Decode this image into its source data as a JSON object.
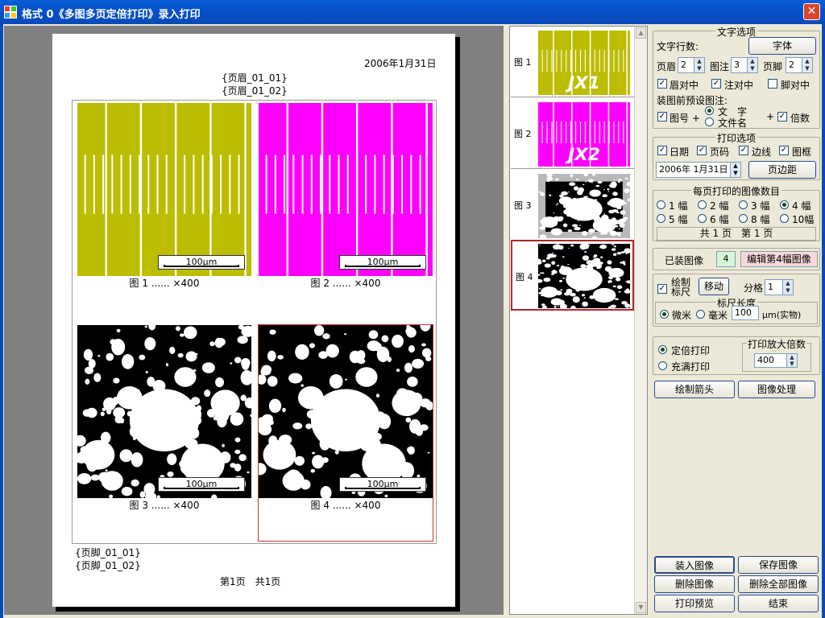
{
  "window": {
    "title": "格式 0《多图多页定倍打印》录入打印",
    "close_glyph": "✕"
  },
  "page": {
    "date": "2006年1月31日",
    "header_lines": [
      "{页眉_01_01}",
      "{页眉_01_02}"
    ],
    "footer_lines": [
      "{页脚_01_01}",
      "{页脚_01_02}"
    ],
    "page_info": "第1页　共1页"
  },
  "figures": [
    {
      "caption": "图 1 ...... ×400",
      "scale_label": "100μm",
      "color": "#bcbc00",
      "kind": "stripes"
    },
    {
      "caption": "图 2 ...... ×400",
      "scale_label": "100μm",
      "color": "#ff00ff",
      "kind": "stripes"
    },
    {
      "caption": "图 3 ...... ×400",
      "scale_label": "100μm",
      "color": "#000000",
      "kind": "particles"
    },
    {
      "caption": "图 4 ...... ×400",
      "scale_label": "100μm",
      "color": "#000000",
      "kind": "particles",
      "selected": true
    }
  ],
  "thumbnails": [
    {
      "label": "图 1",
      "text": "JX1",
      "color": "#bcbc00"
    },
    {
      "label": "图 2",
      "text": "JX2",
      "color": "#ff00ff"
    },
    {
      "label": "图 3",
      "text": "",
      "color": "#000000"
    },
    {
      "label": "图 4",
      "text": "",
      "color": "#000000",
      "selected": true
    }
  ],
  "text_options": {
    "group_title": "文字选项",
    "lines_label": "文字行数:",
    "font_button": "字体",
    "header_label": "页眉",
    "header_value": "2",
    "note_label": "图注",
    "note_value": "3",
    "footer_label": "页脚",
    "footer_value": "2",
    "header_center": "眉对中",
    "note_center": "注对中",
    "footer_center": "脚对中",
    "preset_label": "装图前预设图注:",
    "fig_no": "图号 +",
    "radio_text": "文　字",
    "radio_filename": "文件名",
    "plus": "+",
    "magnification": "倍数"
  },
  "print_options": {
    "group_title": "打印选项",
    "date": "日期",
    "page_no": "页码",
    "border": "边线",
    "frame": "图框",
    "date_value": "2006年 1月31日",
    "margin_button": "页边距"
  },
  "per_page": {
    "group_title": "每页打印的图像数目",
    "options": [
      "1 幅",
      "2 幅",
      "3 幅",
      "4 幅",
      "5 幅",
      "6 幅",
      "8 幅",
      "10幅"
    ],
    "selected_index": 3,
    "summary": "共 1 页　第 1 页"
  },
  "loaded": {
    "label": "已装图像",
    "count": "4",
    "edit_button": "编辑第4幅图像"
  },
  "scale": {
    "draw_label": "绘制标尺",
    "move_button": "移动",
    "divisions_label": "分格",
    "divisions_value": "1",
    "length_title": "标尺长度",
    "micron": "微米",
    "mm": "毫米",
    "length_value": "100",
    "unit": "μm(实物)"
  },
  "print_mode": {
    "fixed": "定倍打印",
    "fill": "充满打印",
    "mag_title": "打印放大倍数",
    "mag_value": "400"
  },
  "buttons": {
    "draw_arrow": "绘制箭头",
    "image_process": "图像处理",
    "load": "装入图像",
    "save": "保存图像",
    "delete": "删除图像",
    "delete_all": "删除全部图像",
    "print_preview": "打印预览",
    "finish": "结束"
  },
  "colors": {
    "title_bar": "#0a4ab8",
    "selection": "#c83232",
    "loaded_count_bg": "#d8f5d8",
    "edit_button_bg": "#f8d8d8"
  }
}
